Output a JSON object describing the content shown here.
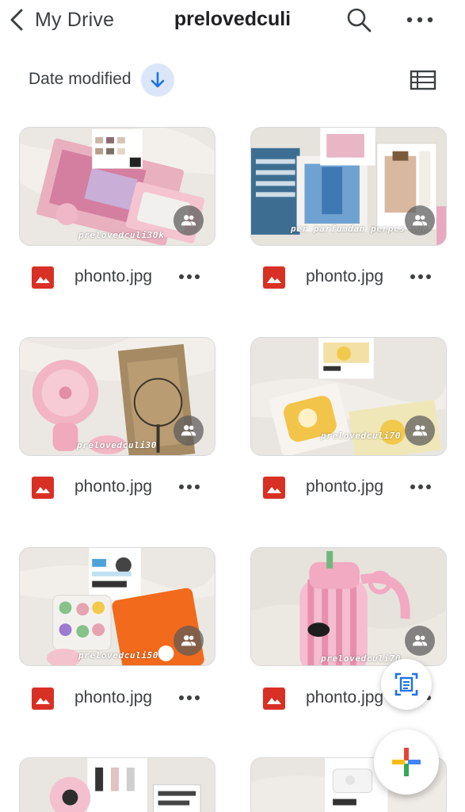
{
  "header": {
    "back_label": "My Drive",
    "title": "prelovedculi",
    "search_icon": "search-icon",
    "more_icon": "more-horizontal-icon"
  },
  "sort": {
    "label": "Date modified",
    "direction_icon": "arrow-down-icon",
    "view_icon": "list-view-icon"
  },
  "files": [
    {
      "name": "phonto.jpg",
      "watermark": "prelovedculi30k",
      "shared": true
    },
    {
      "name": "phonto.jpg",
      "watermark": "per parfumdan perpcs 10k",
      "shared": true
    },
    {
      "name": "phonto.jpg",
      "watermark": "prelovedculi30",
      "shared": true
    },
    {
      "name": "phonto.jpg",
      "watermark": "prelovedculi70",
      "shared": true
    },
    {
      "name": "phonto.jpg",
      "watermark": "prelovedculi50",
      "shared": true
    },
    {
      "name": "phonto.jpg",
      "watermark": "prelovedculi70",
      "shared": true
    },
    {
      "name": "",
      "watermark": "",
      "shared": false
    },
    {
      "name": "",
      "watermark": "",
      "shared": false
    }
  ],
  "colors": {
    "accent": "#1a73e8",
    "image_icon": "#d93025",
    "sort_bg": "#dbe7f8"
  },
  "fabs": {
    "scan_icon": "scan-document-icon",
    "new_icon": "google-plus-icon"
  }
}
